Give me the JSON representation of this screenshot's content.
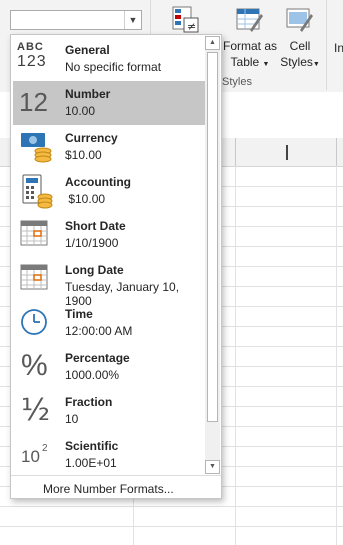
{
  "ribbon": {
    "format_as_table_label_1": "Format as",
    "format_as_table_label_2": "Table",
    "cell_styles_label_1": "Cell",
    "cell_styles_label_2": "Styles",
    "insert_partial": "In",
    "group_label": "Styles"
  },
  "number_format_combo": {
    "value": ""
  },
  "dropdown": {
    "items": [
      {
        "name": "General",
        "sample": "No specific format",
        "icon": "abc-123-icon",
        "selected": false
      },
      {
        "name": "Number",
        "sample": "10.00",
        "icon": "number-12-icon",
        "selected": true
      },
      {
        "name": "Currency",
        "sample": "$10.00",
        "icon": "currency-icon",
        "selected": false
      },
      {
        "name": "Accounting",
        "sample": " $10.00",
        "icon": "accounting-icon",
        "selected": false
      },
      {
        "name": "Short Date",
        "sample": "1/10/1900",
        "icon": "calendar-icon",
        "selected": false
      },
      {
        "name": "Long Date",
        "sample": "Tuesday, January 10, 1900",
        "icon": "calendar-icon",
        "selected": false
      },
      {
        "name": "Time",
        "sample": "12:00:00 AM",
        "icon": "clock-icon",
        "selected": false
      },
      {
        "name": "Percentage",
        "sample": "1000.00%",
        "icon": "percent-icon",
        "selected": false
      },
      {
        "name": "Fraction",
        "sample": "10",
        "icon": "fraction-icon",
        "selected": false
      },
      {
        "name": "Scientific",
        "sample": "1.00E+01",
        "icon": "scientific-icon",
        "selected": false
      }
    ],
    "icon_text": {
      "abc": "ABC",
      "n123": "123",
      "twelve": "12",
      "percent": "%",
      "fraction": "½",
      "ten": "10",
      "exp": "2"
    },
    "more_formats": "More Number Formats..."
  }
}
